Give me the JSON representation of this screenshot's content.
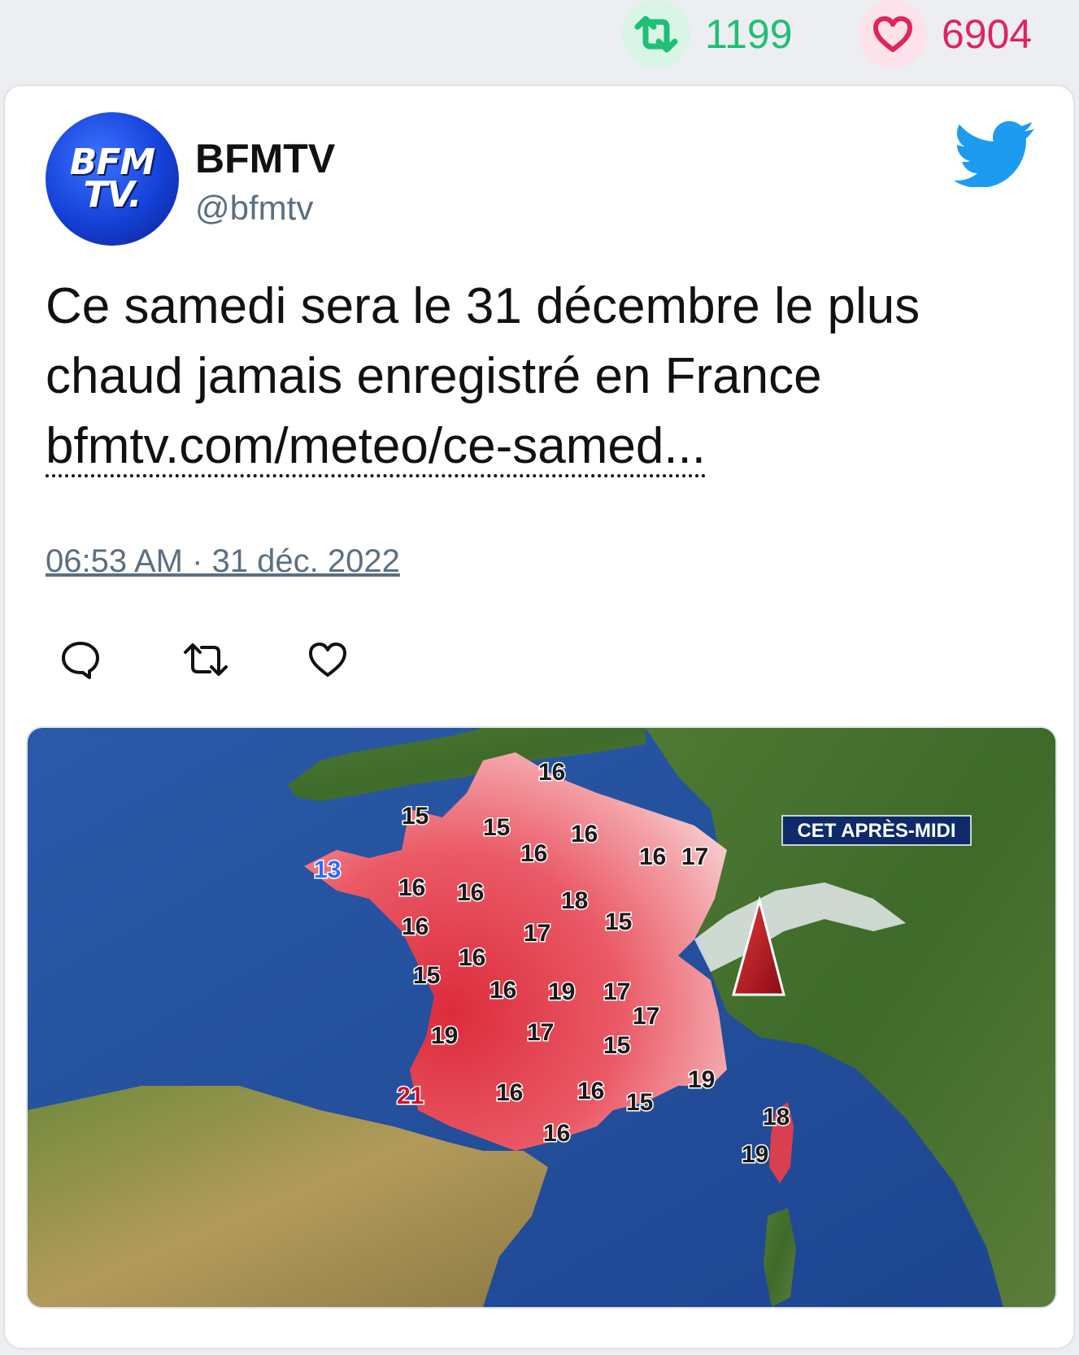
{
  "stats": {
    "retweets": "1199",
    "likes": "6904"
  },
  "tweet": {
    "author_name": "BFMTV",
    "author_handle": "@bfmtv",
    "avatar_text_top": "BFM",
    "avatar_text_bottom": "TV.",
    "text_line1": "Ce samedi sera le 31 décembre le plus",
    "text_line2": "chaud jamais enregistré en France",
    "link_text": "bfmtv.com/meteo/ce-samed...",
    "timestamp": "06:53 AM · 31 déc. 2022"
  },
  "icons": {
    "retweet_stat": "retweet-icon",
    "like_stat": "heart-icon",
    "brand": "twitter-bird-icon",
    "reply": "reply-icon",
    "retweet": "retweet-icon",
    "like": "heart-icon"
  },
  "map": {
    "banner": "CET APRÈS-MIDI",
    "temperatures": [
      {
        "value": "16",
        "color": "#1a1a1a"
      },
      {
        "value": "15",
        "color": "#1a1a1a"
      },
      {
        "value": "15",
        "color": "#1a1a1a"
      },
      {
        "value": "16",
        "color": "#1a1a1a"
      },
      {
        "value": "16",
        "color": "#1a1a1a"
      },
      {
        "value": "16",
        "color": "#1a1a1a"
      },
      {
        "value": "17",
        "color": "#1a1a1a"
      },
      {
        "value": "13",
        "color": "#2a6cff"
      },
      {
        "value": "16",
        "color": "#1a1a1a"
      },
      {
        "value": "16",
        "color": "#1a1a1a"
      },
      {
        "value": "18",
        "color": "#1a1a1a"
      },
      {
        "value": "16",
        "color": "#1a1a1a"
      },
      {
        "value": "15",
        "color": "#1a1a1a"
      },
      {
        "value": "17",
        "color": "#1a1a1a"
      },
      {
        "value": "16",
        "color": "#1a1a1a"
      },
      {
        "value": "15",
        "color": "#1a1a1a"
      },
      {
        "value": "16",
        "color": "#1a1a1a"
      },
      {
        "value": "19",
        "color": "#1a1a1a"
      },
      {
        "value": "17",
        "color": "#1a1a1a"
      },
      {
        "value": "17",
        "color": "#1a1a1a"
      },
      {
        "value": "19",
        "color": "#1a1a1a"
      },
      {
        "value": "17",
        "color": "#1a1a1a"
      },
      {
        "value": "15",
        "color": "#1a1a1a"
      },
      {
        "value": "16",
        "color": "#1a1a1a"
      },
      {
        "value": "21",
        "color": "#d0102a"
      },
      {
        "value": "16",
        "color": "#1a1a1a"
      },
      {
        "value": "15",
        "color": "#1a1a1a"
      },
      {
        "value": "19",
        "color": "#1a1a1a"
      },
      {
        "value": "16",
        "color": "#1a1a1a"
      },
      {
        "value": "18",
        "color": "#1a1a1a"
      },
      {
        "value": "19",
        "color": "#1a1a1a"
      }
    ]
  },
  "colors": {
    "retweet_green": "#1fbf75",
    "like_pink": "#e0245e",
    "twitter_blue": "#1d9bf0",
    "muted": "#5b6f82"
  }
}
